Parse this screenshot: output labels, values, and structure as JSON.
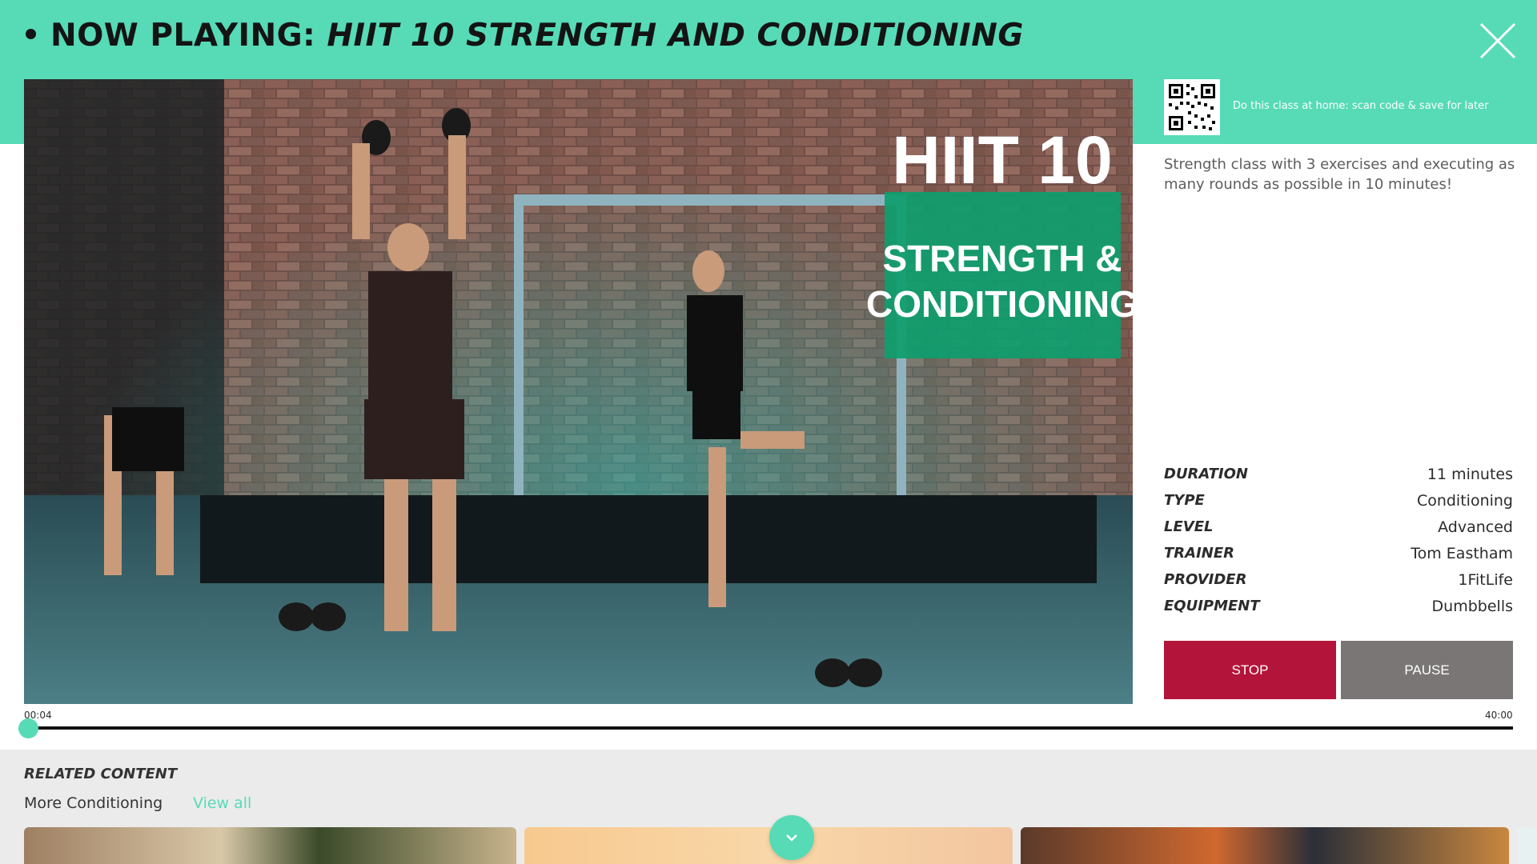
{
  "header": {
    "prefix": "NOW PLAYING:",
    "class_name": "HIIT 10 STRENGTH AND CONDITIONING"
  },
  "video": {
    "overlay_line1": "HIIT 10",
    "overlay_line2": "STRENGTH &",
    "overlay_line3": "CONDITIONING"
  },
  "qr": {
    "caption": "Do this class at home: scan code & save for later"
  },
  "description": "Strength class with 3 exercises and executing as many rounds as possible in 10 minutes!",
  "details": [
    {
      "label": "DURATION",
      "value": "11 minutes"
    },
    {
      "label": "TYPE",
      "value": "Conditioning"
    },
    {
      "label": "LEVEL",
      "value": "Advanced"
    },
    {
      "label": "TRAINER",
      "value": "Tom Eastham"
    },
    {
      "label": "PROVIDER",
      "value": "1FitLife"
    },
    {
      "label": "EQUIPMENT",
      "value": "Dumbbells"
    }
  ],
  "controls": {
    "stop_label": "STOP",
    "pause_label": "PAUSE"
  },
  "progress": {
    "current": "00:04",
    "total": "40:00",
    "fraction": 0.0017
  },
  "related": {
    "title": "RELATED CONTENT",
    "category": "More Conditioning",
    "view_all": "View all"
  },
  "colors": {
    "accent": "#56dbb6",
    "stop": "#b3153a",
    "pause": "#7a7676"
  },
  "icons": {
    "close": "close-icon",
    "scroll": "chevron-down-icon"
  }
}
